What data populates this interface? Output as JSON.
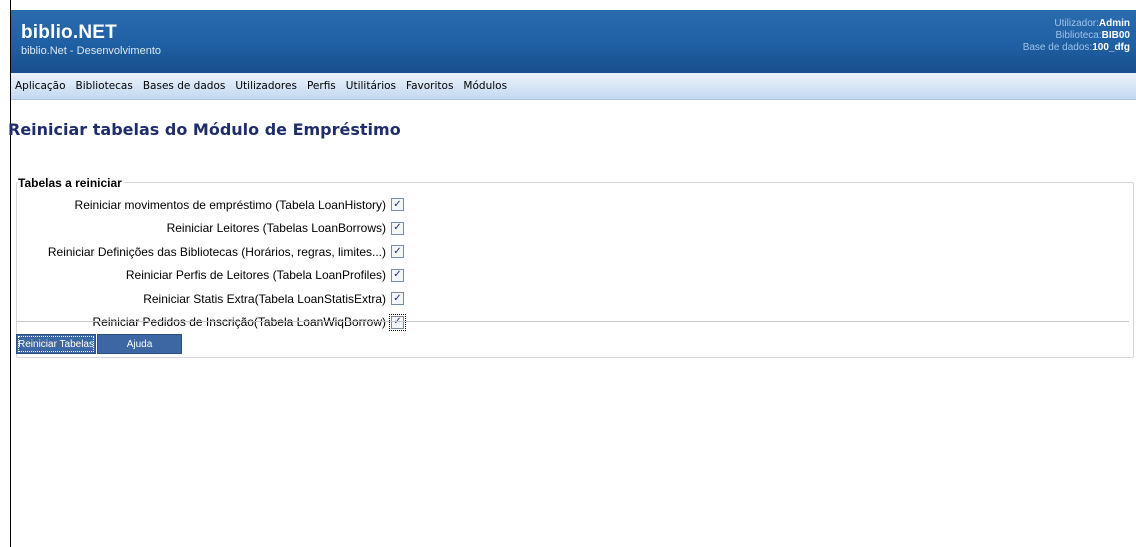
{
  "header": {
    "title": "biblio.NET",
    "subtitle": "biblio.Net - Desenvolvimento",
    "user_label": "Utilizador:",
    "user_value": "Admin",
    "library_label": "Biblioteca:",
    "library_value": "BIB00",
    "db_label": "Base de dados:",
    "db_value": "100_dfg"
  },
  "menu": {
    "items": [
      {
        "label": "Aplicação"
      },
      {
        "label": "Bibliotecas"
      },
      {
        "label": "Bases de dados"
      },
      {
        "label": "Utilizadores"
      },
      {
        "label": "Perfis"
      },
      {
        "label": "Utilitários"
      },
      {
        "label": "Favoritos"
      },
      {
        "label": "Módulos"
      }
    ]
  },
  "page": {
    "title": "Reiniciar tabelas do Módulo de Empréstimo",
    "group_title": "Tabelas a reiniciar",
    "check_mark": "✓",
    "options": [
      {
        "label": "Reiniciar movimentos de empréstimo (Tabela LoanHistory)",
        "checked": true
      },
      {
        "label": "Reiniciar Leitores (Tabelas LoanBorrows)",
        "checked": true
      },
      {
        "label": "Reiniciar Definições das Bibliotecas (Horários, regras, limites...)",
        "checked": true
      },
      {
        "label": "Reiniciar Perfis de Leitores (Tabela LoanProfiles)",
        "checked": true
      },
      {
        "label": "Reiniciar Statis Extra(Tabela LoanStatisExtra)",
        "checked": true
      },
      {
        "label": "Reiniciar Pedidos de Inscrição(Tabela LoanWiqBorrow)",
        "checked": true
      }
    ],
    "reset_button": "Reiniciar Tabelas",
    "help_button": "Ajuda"
  },
  "colors": {
    "header_bg": "#1f5fa3",
    "menu_bg": "#d3e3f5",
    "title": "#1f2e6b",
    "button_bg": "#3c67a2"
  }
}
